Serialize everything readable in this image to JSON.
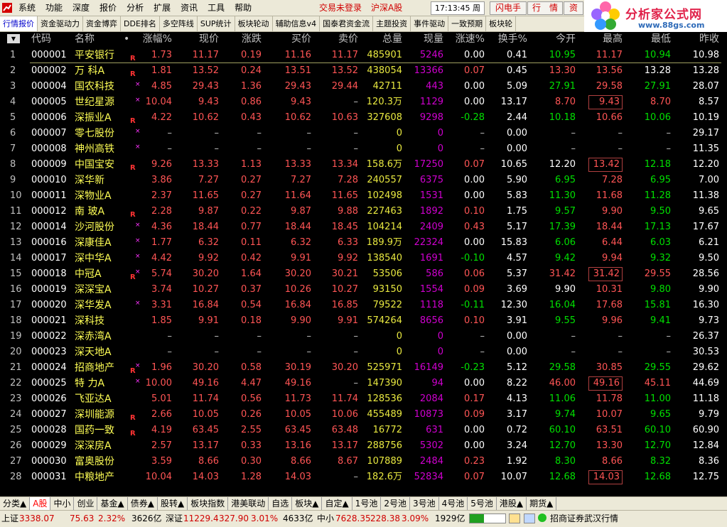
{
  "menu": {
    "items": [
      "系统",
      "功能",
      "深度",
      "报价",
      "分析",
      "扩展",
      "资讯",
      "工具",
      "帮助"
    ]
  },
  "login_status": "交易未登录",
  "market_name": "沪深A股",
  "clock": "17:13:45 周四",
  "top_buttons": [
    "闪电手",
    "行　情",
    "资"
  ],
  "brand": {
    "name": "分析家公式网",
    "url": "www.88gs.com"
  },
  "tabs": [
    "行情报价",
    "资金驱动力",
    "资金博弈",
    "DDE排名",
    "多空阵线",
    "SUP统计",
    "板块轮动",
    "辅助信息v4",
    "国泰君资金流",
    "主题投资",
    "事件驱动",
    "一致预期",
    "板块轮"
  ],
  "table": {
    "sort_icon": "▼",
    "headers": [
      "代码",
      "名称",
      "•",
      "涨幅%",
      "现价",
      "涨跌",
      "买价",
      "卖价",
      "总量",
      "现量",
      "涨速%",
      "换手%",
      "今开",
      "最高",
      "最低",
      "昨收"
    ],
    "rows": [
      [
        "1",
        "000001",
        "平安银行",
        "1.73",
        "11.17",
        "0.19",
        "11.16",
        "11.17",
        "485901",
        "5246",
        "0.00",
        "0.41",
        "10.95",
        "11.17",
        "10.94",
        "10.98"
      ],
      [
        "2",
        "000002",
        "万 科A",
        "1.81",
        "13.52",
        "0.24",
        "13.51",
        "13.52",
        "438054",
        "13366",
        "0.07",
        "0.45",
        "13.30",
        "13.56",
        "13.28",
        "13.28"
      ],
      [
        "3",
        "000004",
        "国农科技",
        "4.85",
        "29.43",
        "1.36",
        "29.43",
        "29.44",
        "42711",
        "443",
        "0.00",
        "5.09",
        "27.91",
        "29.58",
        "27.91",
        "28.07"
      ],
      [
        "4",
        "000005",
        "世纪星源",
        "10.04",
        "9.43",
        "0.86",
        "9.43",
        "–",
        "120.3万",
        "1129",
        "0.00",
        "13.17",
        "8.70",
        "9.43",
        "8.70",
        "8.57"
      ],
      [
        "5",
        "000006",
        "深振业A",
        "4.22",
        "10.62",
        "0.43",
        "10.62",
        "10.63",
        "327608",
        "9298",
        "-0.28",
        "2.44",
        "10.18",
        "10.66",
        "10.06",
        "10.19"
      ],
      [
        "6",
        "000007",
        "零七股份",
        "–",
        "–",
        "–",
        "–",
        "–",
        "0",
        "0",
        "–",
        "0.00",
        "–",
        "–",
        "–",
        "29.17"
      ],
      [
        "7",
        "000008",
        "神州高铁",
        "–",
        "–",
        "–",
        "–",
        "–",
        "0",
        "0",
        "–",
        "0.00",
        "–",
        "–",
        "–",
        "11.35"
      ],
      [
        "8",
        "000009",
        "中国宝安",
        "9.26",
        "13.33",
        "1.13",
        "13.33",
        "13.34",
        "158.6万",
        "17250",
        "0.07",
        "10.65",
        "12.20",
        "13.42",
        "12.18",
        "12.20"
      ],
      [
        "9",
        "000010",
        "深华新",
        "3.86",
        "7.27",
        "0.27",
        "7.27",
        "7.28",
        "240557",
        "6375",
        "0.00",
        "5.90",
        "6.95",
        "7.28",
        "6.95",
        "7.00"
      ],
      [
        "10",
        "000011",
        "深物业A",
        "2.37",
        "11.65",
        "0.27",
        "11.64",
        "11.65",
        "102498",
        "1531",
        "0.00",
        "5.83",
        "11.30",
        "11.68",
        "11.28",
        "11.38"
      ],
      [
        "11",
        "000012",
        "南 玻A",
        "2.28",
        "9.87",
        "0.22",
        "9.87",
        "9.88",
        "227463",
        "1892",
        "0.10",
        "1.75",
        "9.57",
        "9.90",
        "9.50",
        "9.65"
      ],
      [
        "12",
        "000014",
        "沙河股份",
        "4.36",
        "18.44",
        "0.77",
        "18.44",
        "18.45",
        "104214",
        "2409",
        "0.43",
        "5.17",
        "17.39",
        "18.44",
        "17.13",
        "17.67"
      ],
      [
        "13",
        "000016",
        "深康佳A",
        "1.77",
        "6.32",
        "0.11",
        "6.32",
        "6.33",
        "189.9万",
        "22324",
        "0.00",
        "15.83",
        "6.06",
        "6.44",
        "6.03",
        "6.21"
      ],
      [
        "14",
        "000017",
        "深中华A",
        "4.42",
        "9.92",
        "0.42",
        "9.91",
        "9.92",
        "138540",
        "1691",
        "-0.10",
        "4.57",
        "9.42",
        "9.94",
        "9.32",
        "9.50"
      ],
      [
        "15",
        "000018",
        "中冠A",
        "5.74",
        "30.20",
        "1.64",
        "30.20",
        "30.21",
        "53506",
        "586",
        "0.06",
        "5.37",
        "31.42",
        "31.42",
        "29.55",
        "28.56"
      ],
      [
        "16",
        "000019",
        "深深宝A",
        "3.74",
        "10.27",
        "0.37",
        "10.26",
        "10.27",
        "93150",
        "1554",
        "0.09",
        "3.69",
        "9.90",
        "10.31",
        "9.80",
        "9.90"
      ],
      [
        "17",
        "000020",
        "深华发A",
        "3.31",
        "16.84",
        "0.54",
        "16.84",
        "16.85",
        "79522",
        "1118",
        "-0.11",
        "12.30",
        "16.04",
        "17.68",
        "15.81",
        "16.30"
      ],
      [
        "18",
        "000021",
        "深科技",
        "1.85",
        "9.91",
        "0.18",
        "9.90",
        "9.91",
        "574264",
        "8656",
        "0.10",
        "3.91",
        "9.55",
        "9.96",
        "9.41",
        "9.73"
      ],
      [
        "19",
        "000022",
        "深赤湾A",
        "–",
        "–",
        "–",
        "–",
        "–",
        "0",
        "0",
        "–",
        "0.00",
        "–",
        "–",
        "–",
        "26.37"
      ],
      [
        "20",
        "000023",
        "深天地A",
        "–",
        "–",
        "–",
        "–",
        "–",
        "0",
        "0",
        "–",
        "0.00",
        "–",
        "–",
        "–",
        "30.53"
      ],
      [
        "21",
        "000024",
        "招商地产",
        "1.96",
        "30.20",
        "0.58",
        "30.19",
        "30.20",
        "525971",
        "16149",
        "-0.23",
        "5.12",
        "29.58",
        "30.85",
        "29.55",
        "29.62"
      ],
      [
        "22",
        "000025",
        "特 力A",
        "10.00",
        "49.16",
        "4.47",
        "49.16",
        "–",
        "147390",
        "94",
        "0.00",
        "8.22",
        "46.00",
        "49.16",
        "45.11",
        "44.69"
      ],
      [
        "23",
        "000026",
        "飞亚达A",
        "5.01",
        "11.74",
        "0.56",
        "11.73",
        "11.74",
        "128536",
        "2084",
        "0.17",
        "4.13",
        "11.06",
        "11.78",
        "11.00",
        "11.18"
      ],
      [
        "24",
        "000027",
        "深圳能源",
        "2.66",
        "10.05",
        "0.26",
        "10.05",
        "10.06",
        "455489",
        "10873",
        "0.09",
        "3.17",
        "9.74",
        "10.07",
        "9.65",
        "9.79"
      ],
      [
        "25",
        "000028",
        "国药一致",
        "4.19",
        "63.45",
        "2.55",
        "63.45",
        "63.48",
        "16772",
        "631",
        "0.00",
        "0.72",
        "60.10",
        "63.51",
        "60.10",
        "60.90"
      ],
      [
        "26",
        "000029",
        "深深房A",
        "2.57",
        "13.17",
        "0.33",
        "13.16",
        "13.17",
        "288756",
        "5302",
        "0.00",
        "3.24",
        "12.70",
        "13.30",
        "12.70",
        "12.84"
      ],
      [
        "27",
        "000030",
        "富奥股份",
        "3.59",
        "8.66",
        "0.30",
        "8.66",
        "8.67",
        "107889",
        "2484",
        "0.23",
        "1.92",
        "8.30",
        "8.66",
        "8.32",
        "8.36"
      ],
      [
        "28",
        "000031",
        "中粮地产",
        "10.04",
        "14.03",
        "1.28",
        "14.03",
        "–",
        "182.6万",
        "52834",
        "0.07",
        "10.07",
        "12.68",
        "14.03",
        "12.68",
        "12.75"
      ]
    ],
    "r_flags": [
      "1",
      "2",
      "5",
      "8",
      "11",
      "15",
      "21",
      "24",
      "25"
    ],
    "x_flags": [
      "3",
      "4",
      "6",
      "7",
      "12",
      "13",
      "14",
      "15",
      "17",
      "21",
      "22"
    ]
  },
  "bottom_tabs": [
    "分类▲",
    "A股",
    "中小",
    "创业",
    "基金▲",
    "债券▲",
    "股转▲",
    "板块指数",
    "港美联动",
    "自选",
    "板块▲",
    "自定▲",
    "1号池",
    "2号池",
    "3号池",
    "4号池",
    "5号池",
    "港股▲",
    "期货▲"
  ],
  "status": {
    "sh_label": "上证",
    "sh_index": "3338.07",
    "sh_change": "75.63",
    "sh_pct": "2.32%",
    "sh_amount": "3626亿",
    "sz_label": "深证",
    "sz_index": "11229.4",
    "sz_change": "327.90",
    "sz_pct": "3.01%",
    "sz_amount": "4633亿",
    "zx_label": "中小",
    "zx_index": "7628.35",
    "zx_change": "228.38",
    "zx_pct": "3.09%",
    "zx_amount": "1929亿",
    "broker": "招商证券武汉行情"
  },
  "colors": {
    "up": "#ff5555",
    "down": "#00e000",
    "volume": "#e8e840",
    "last_volume": "#d000d0",
    "name": "#ffff55",
    "background": "#000000"
  }
}
